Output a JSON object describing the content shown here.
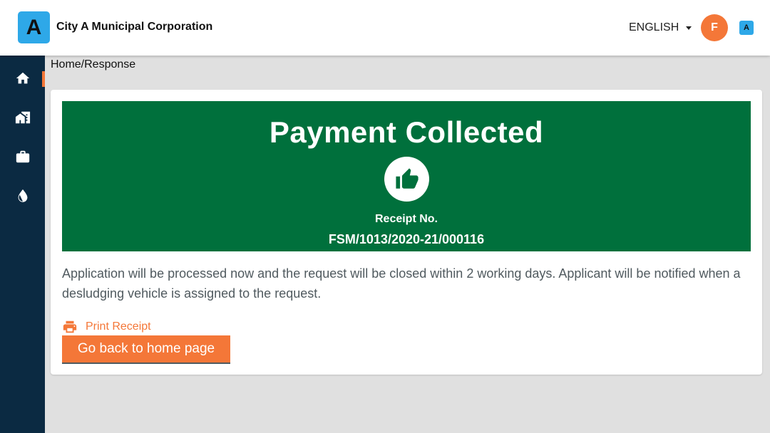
{
  "header": {
    "logo_letter": "A",
    "org_name": "City A Municipal Corporation",
    "language": "ENGLISH",
    "avatar_initial": "F",
    "mini_logo_letter": "A"
  },
  "sidebar": {
    "items": [
      {
        "icon": "home-icon"
      },
      {
        "icon": "building-icon"
      },
      {
        "icon": "briefcase-icon"
      },
      {
        "icon": "water-drop-icon"
      }
    ]
  },
  "breadcrumb": "Home/Response",
  "banner": {
    "title": "Payment Collected",
    "icon": "thumbs-up-icon",
    "receipt_label": "Receipt No.",
    "receipt_number": "FSM/1013/2020-21/000116"
  },
  "message": "Application will be processed now and the request will be closed within 2 working days. Applicant will be notified when a desludging vehicle is assigned to the request.",
  "actions": {
    "print_label": "Print Receipt",
    "home_button_label": "Go back to home page"
  },
  "colors": {
    "success_green": "#00703c",
    "accent_orange": "#f47738",
    "sidebar_navy": "#0b2a42",
    "logo_blue": "#2ea8e8"
  }
}
